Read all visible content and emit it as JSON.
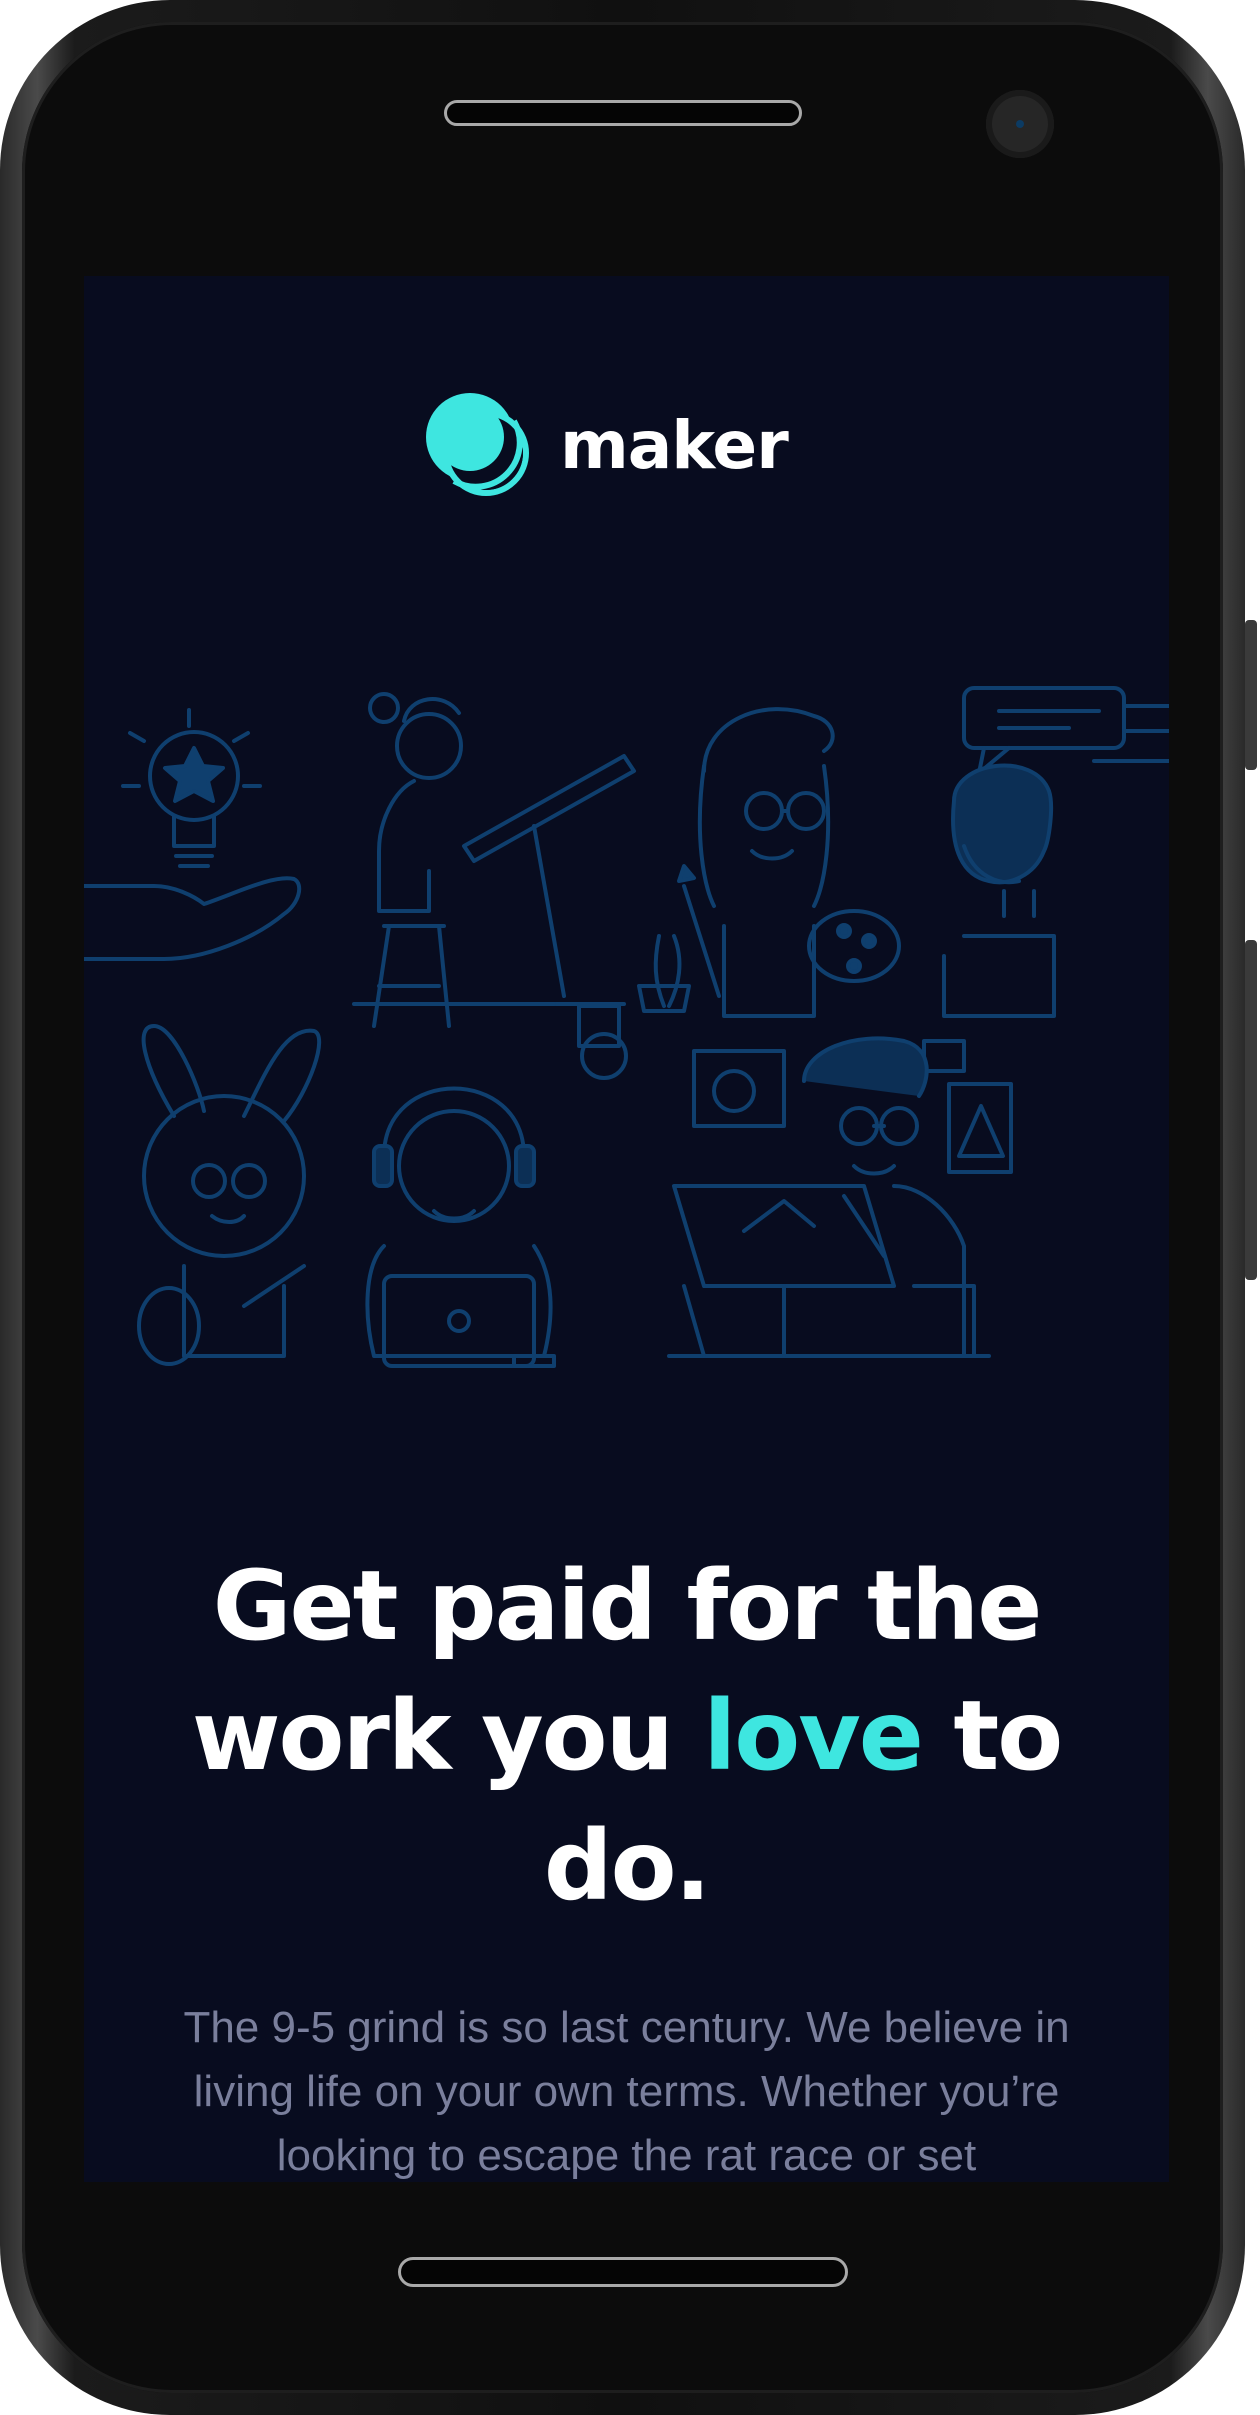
{
  "brand": {
    "name": "maker",
    "accent_color": "#3ee6e0",
    "logo_icon": "maker-logo-icon"
  },
  "hero": {
    "headline_part1": "Get paid for the work you ",
    "headline_accent": "love",
    "headline_part2": " to do.",
    "body": "The 9-5 grind is so last century. We believe in living life on your own terms. Whether you’re looking to escape the rat race or set"
  },
  "colors": {
    "background": "#080c1f",
    "illustration_stroke": "#0f3f6e",
    "body_text": "#7a7f9c"
  }
}
